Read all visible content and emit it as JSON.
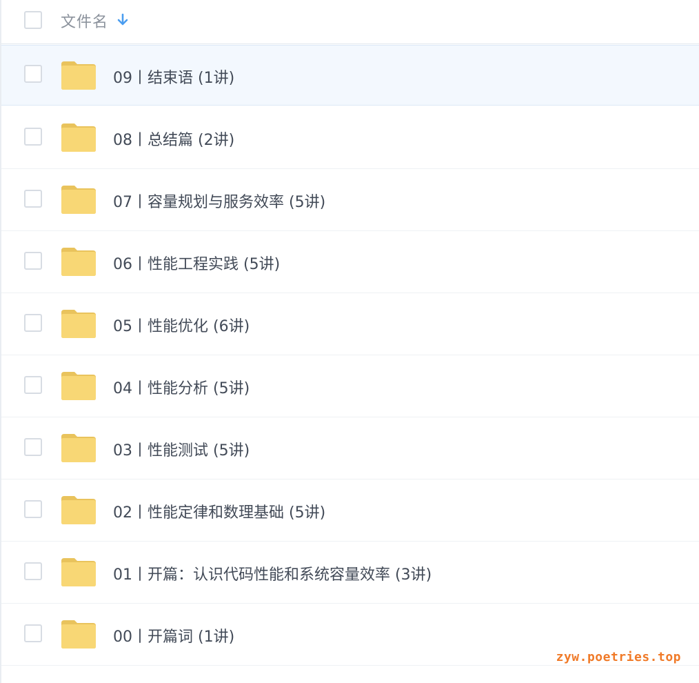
{
  "header": {
    "column_label": "文件名",
    "sort_icon": "arrow-down-icon",
    "accent_color": "#4a9df0"
  },
  "folders": [
    {
      "label": "09丨结束语 (1讲)",
      "selected": true
    },
    {
      "label": "08丨总结篇 (2讲)",
      "selected": false
    },
    {
      "label": "07丨容量规划与服务效率 (5讲)",
      "selected": false
    },
    {
      "label": "06丨性能工程实践 (5讲)",
      "selected": false
    },
    {
      "label": "05丨性能优化 (6讲)",
      "selected": false
    },
    {
      "label": "04丨性能分析 (5讲)",
      "selected": false
    },
    {
      "label": "03丨性能测试 (5讲)",
      "selected": false
    },
    {
      "label": "02丨性能定律和数理基础 (5讲)",
      "selected": false
    },
    {
      "label": "01丨开篇：认识代码性能和系统容量效率 (3讲)",
      "selected": false
    },
    {
      "label": "00丨开篇词 (1讲)",
      "selected": false
    }
  ],
  "folder_icon": "folder-icon",
  "folder_color": "#f8d775",
  "watermark": "zyw.poetries.top"
}
